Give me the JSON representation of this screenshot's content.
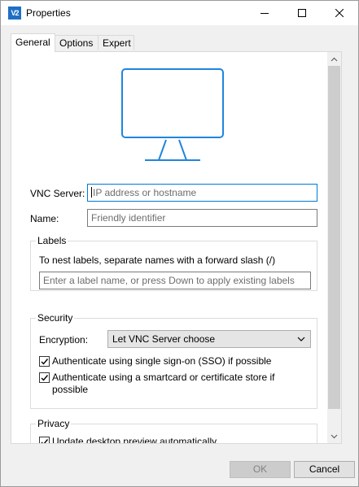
{
  "window": {
    "title": "Properties",
    "icon_text": "V2"
  },
  "tabs": [
    {
      "label": "General",
      "active": true
    },
    {
      "label": "Options",
      "active": false
    },
    {
      "label": "Expert",
      "active": false
    }
  ],
  "general": {
    "vnc_server_label": "VNC Server:",
    "vnc_server_placeholder": "IP address or hostname",
    "name_label": "Name:",
    "name_placeholder": "Friendly identifier",
    "labels": {
      "title": "Labels",
      "instruction": "To nest labels, separate names with a forward slash (/)",
      "input_placeholder": "Enter a label name, or press Down to apply existing labels"
    },
    "security": {
      "title": "Security",
      "encryption_label": "Encryption:",
      "encryption_value": "Let VNC Server choose",
      "sso_label": "Authenticate using single sign-on (SSO) if possible",
      "sso_checked": true,
      "smartcard_label": "Authenticate using a smartcard or certificate store if possible",
      "smartcard_checked": true
    },
    "privacy": {
      "title": "Privacy",
      "preview_label": "Update desktop preview automatically",
      "preview_checked": true
    }
  },
  "buttons": {
    "ok": "OK",
    "cancel": "Cancel"
  },
  "colors": {
    "accent": "#1f85de",
    "focus_border": "#0078d7"
  }
}
